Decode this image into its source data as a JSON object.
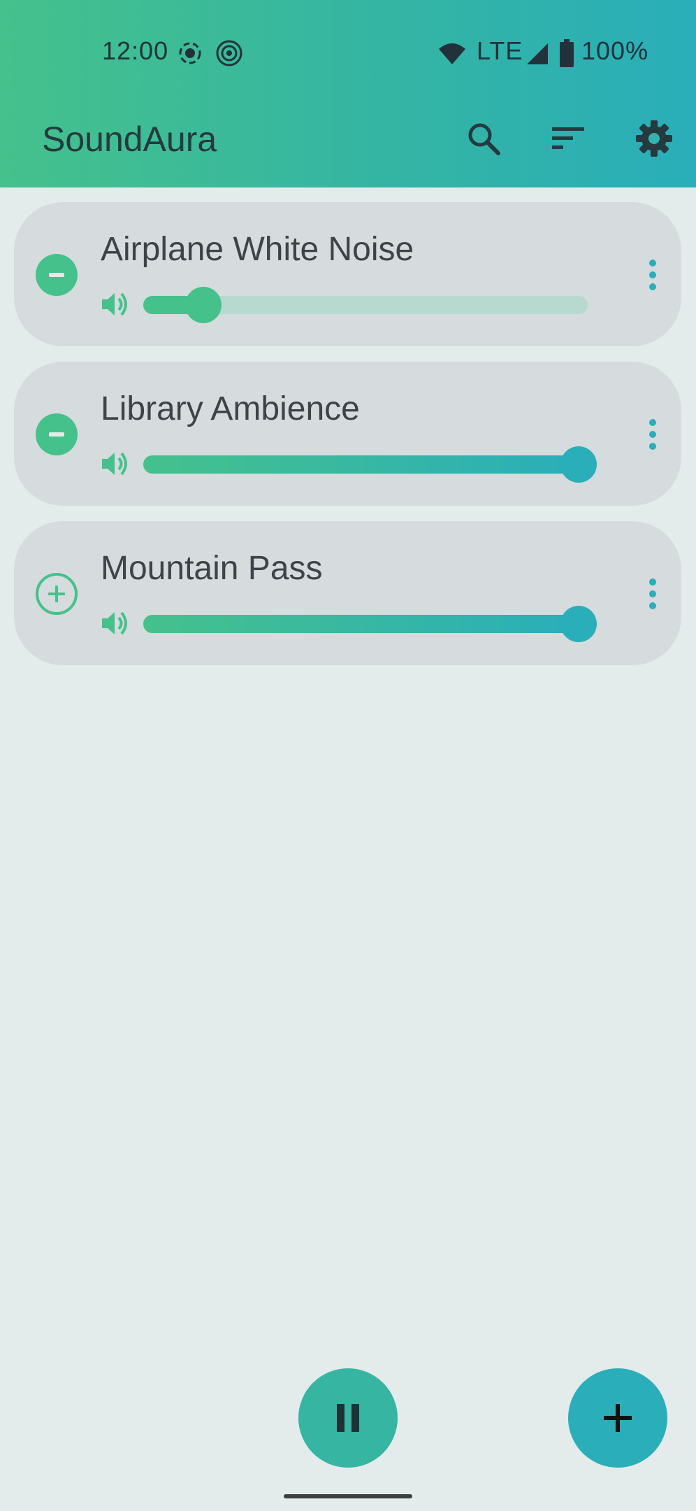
{
  "status_bar": {
    "time": "12:00",
    "network": "LTE",
    "battery": "100%",
    "icons": [
      "screen-record-icon",
      "hotspot-icon",
      "wifi-icon",
      "cell-signal-icon",
      "battery-icon"
    ]
  },
  "app_bar": {
    "title": "SoundAura",
    "actions": [
      "search-icon",
      "sort-icon",
      "settings-icon"
    ]
  },
  "tracks": [
    {
      "name": "Airplane White Noise",
      "playing": true,
      "volume": 0.12,
      "toggle_icon": "remove-icon"
    },
    {
      "name": "Library Ambience",
      "playing": true,
      "volume": 1.0,
      "toggle_icon": "remove-icon"
    },
    {
      "name": "Mountain Pass",
      "playing": false,
      "volume": 1.0,
      "toggle_icon": "add-icon"
    }
  ],
  "colors": {
    "accent_green": "#45c18c",
    "accent_teal": "#2aaeb9",
    "card_bg": "#d6dbdd",
    "page_bg": "#e4ebeb"
  },
  "fabs": {
    "play_pause_icon": "pause-icon",
    "add_icon": "add-icon"
  }
}
